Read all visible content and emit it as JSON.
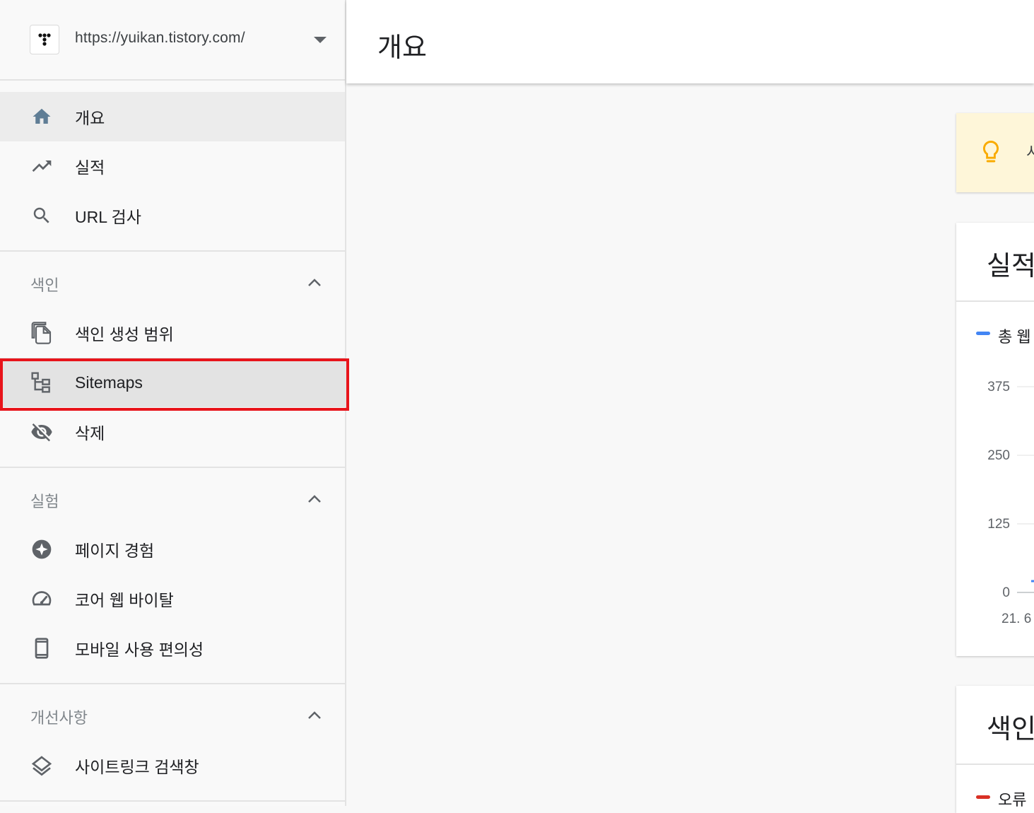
{
  "property": {
    "url": "https://yuikan.tistory.com/"
  },
  "nav": {
    "top_items": [
      {
        "label": "개요",
        "icon": "home-icon"
      },
      {
        "label": "실적",
        "icon": "trending-up-icon"
      },
      {
        "label": "URL 검사",
        "icon": "search-icon"
      }
    ],
    "sections": [
      {
        "title": "색인",
        "items": [
          {
            "label": "색인 생성 범위",
            "icon": "file-copy-icon"
          },
          {
            "label": "Sitemaps",
            "icon": "sitemap-icon"
          },
          {
            "label": "삭제",
            "icon": "visibility-off-icon"
          }
        ]
      },
      {
        "title": "실험",
        "items": [
          {
            "label": "페이지 경험",
            "icon": "star-badge-icon"
          },
          {
            "label": "코어 웹 바이탈",
            "icon": "speedometer-icon"
          },
          {
            "label": "모바일 사용 편의성",
            "icon": "smartphone-icon"
          }
        ]
      },
      {
        "title": "개선사항",
        "items": [
          {
            "label": "사이트링크 검색창",
            "icon": "layers-icon"
          }
        ]
      }
    ]
  },
  "header": {
    "title": "개요"
  },
  "tip": {
    "text": "시"
  },
  "performance_card": {
    "title": "실적",
    "legend": "총 웹"
  },
  "coverage_card": {
    "title": "색인",
    "legend": "오류"
  },
  "colors": {
    "accent_blue": "#4285f4",
    "error_red": "#d93025",
    "tip_yellow": "#f9ab00",
    "highlight_red": "#e8141b"
  },
  "chart_data": {
    "type": "line",
    "title": "실적",
    "legend": [
      "총 웹"
    ],
    "y_ticks": [
      "375",
      "250",
      "125",
      "0"
    ],
    "x_ticks": [
      "21. 6"
    ],
    "ylim": [
      0,
      375
    ],
    "series": [
      {
        "name": "총 웹",
        "values": []
      }
    ]
  }
}
